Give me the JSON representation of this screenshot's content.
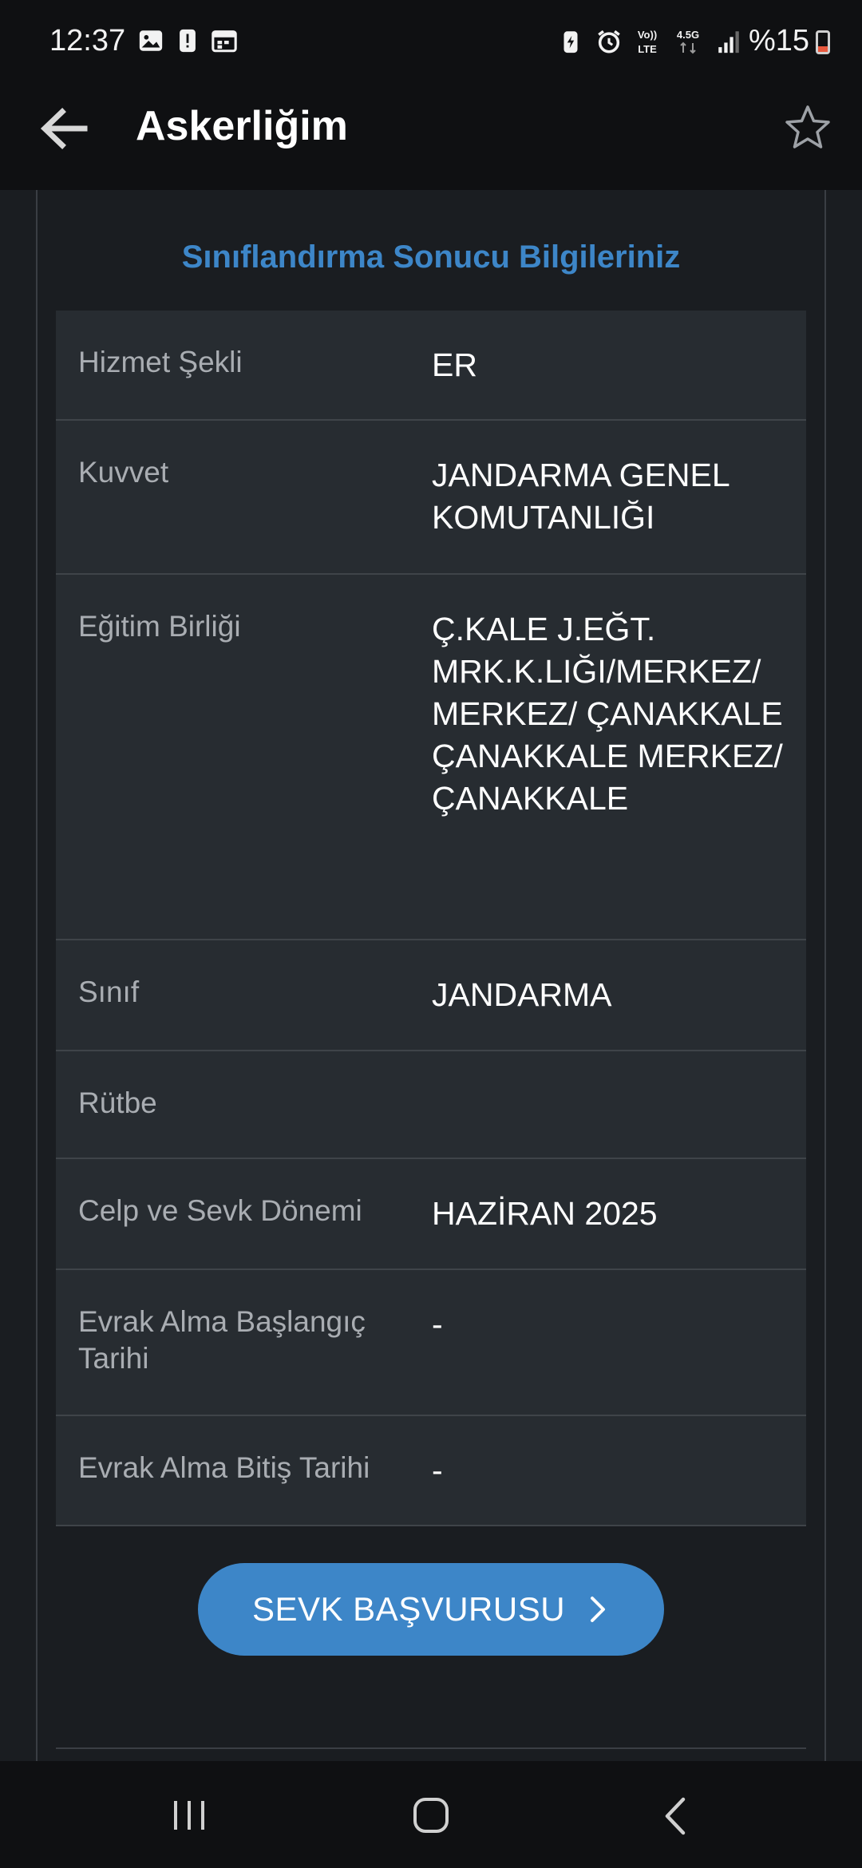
{
  "status_bar": {
    "time": "12:37",
    "battery_text": "%15",
    "network_label_top": "Vo))",
    "network_label_bottom": "LTE",
    "network_gen": "4.5G"
  },
  "header": {
    "title": "Askerliğim"
  },
  "section": {
    "title": "Sınıflandırma Sonucu Bilgileriniz"
  },
  "rows": [
    {
      "label": "Hizmet Şekli",
      "value": "ER"
    },
    {
      "label": "Kuvvet",
      "value": "JANDARMA GENEL KOMUTANLIĞI"
    },
    {
      "label": "Eğitim Birliği",
      "value": "Ç.KALE J.EĞT. MRK.K.LIĞI/MERKEZ/ MERKEZ/ ÇANAKKALE ÇANAKKALE MERKEZ/ ÇANAKKALE"
    },
    {
      "label": "Sınıf",
      "value": "JANDARMA"
    },
    {
      "label": "Rütbe",
      "value": ""
    },
    {
      "label": "Celp ve Sevk Dönemi",
      "value": "HAZİRAN 2025"
    },
    {
      "label": "Evrak Alma Başlangıç Tarihi",
      "value": "-"
    },
    {
      "label": "Evrak Alma Bitiş Tarihi",
      "value": "-"
    }
  ],
  "button": {
    "label": "SEVK BAŞVURUSU"
  },
  "colors": {
    "accent": "#3d86c8",
    "background": "#1a1d21",
    "card": "#272c31",
    "bars": "#0f1012"
  },
  "icons": {
    "back": "back-arrow-icon",
    "favorite": "star-icon",
    "chevron": "chevron-right-icon"
  }
}
